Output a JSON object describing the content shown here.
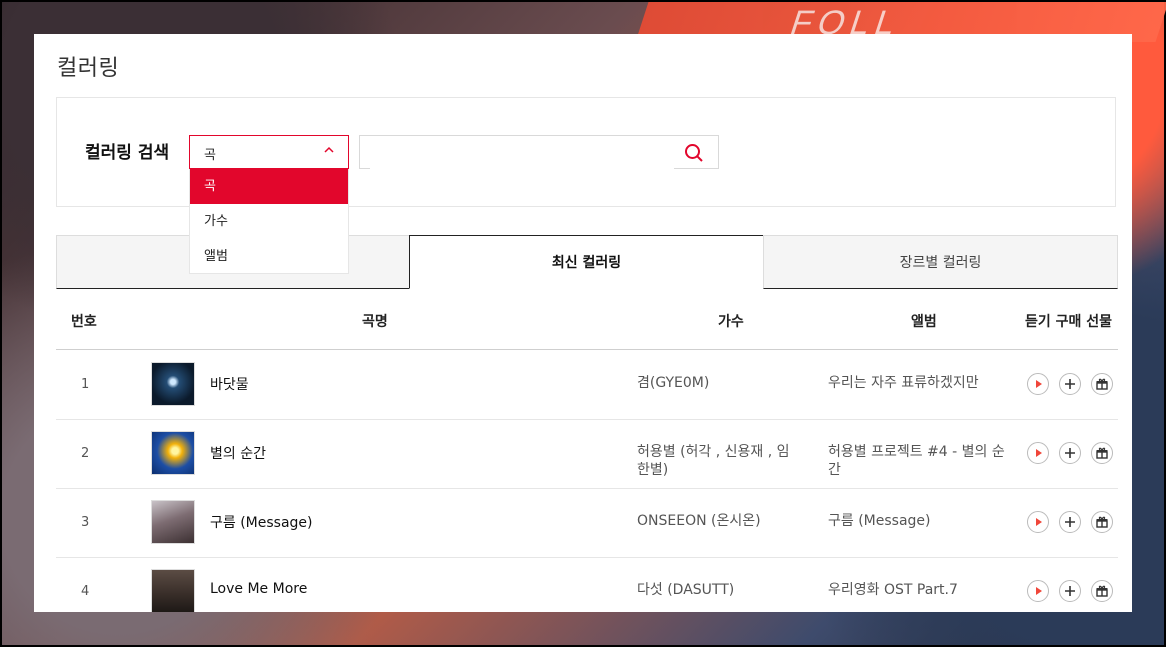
{
  "page_title": "컬러링",
  "background": {
    "text": "FOLL"
  },
  "search": {
    "label": "컬러링 검색",
    "selected": "곡",
    "options": [
      "곡",
      "가수",
      "앨범"
    ],
    "input_value": ""
  },
  "tabs": [
    {
      "label": ""
    },
    {
      "label": "최신 컬러링"
    },
    {
      "label": "장르별 컬러링"
    }
  ],
  "table": {
    "headers": {
      "num": "번호",
      "song": "곡명",
      "artist": "가수",
      "album": "앨범",
      "actions": "듣기 구매 선물"
    },
    "rows": [
      {
        "num": "1",
        "song": "바닷물",
        "artist": "겸(GYE0M)",
        "album": "우리는 자주 표류하겠지만"
      },
      {
        "num": "2",
        "song": "별의 순간",
        "artist": "허용별 (허각 , 신용재 , 임한별)",
        "album": "허용별 프로젝트 #4 - 별의 순간"
      },
      {
        "num": "3",
        "song": "구름 (Message)",
        "artist": "ONSEEON (온시온)",
        "album": "구름 (Message)"
      },
      {
        "num": "4",
        "song": "Love Me More",
        "artist": "다섯 (DASUTT)",
        "album": "우리영화 OST Part.7"
      }
    ]
  },
  "icons": {
    "search": "search-icon",
    "chevron": "chevron-up-icon",
    "play": "play-icon",
    "add": "plus-icon",
    "gift": "gift-icon"
  },
  "colors": {
    "accent": "#e2062c",
    "play": "#f0463a"
  }
}
